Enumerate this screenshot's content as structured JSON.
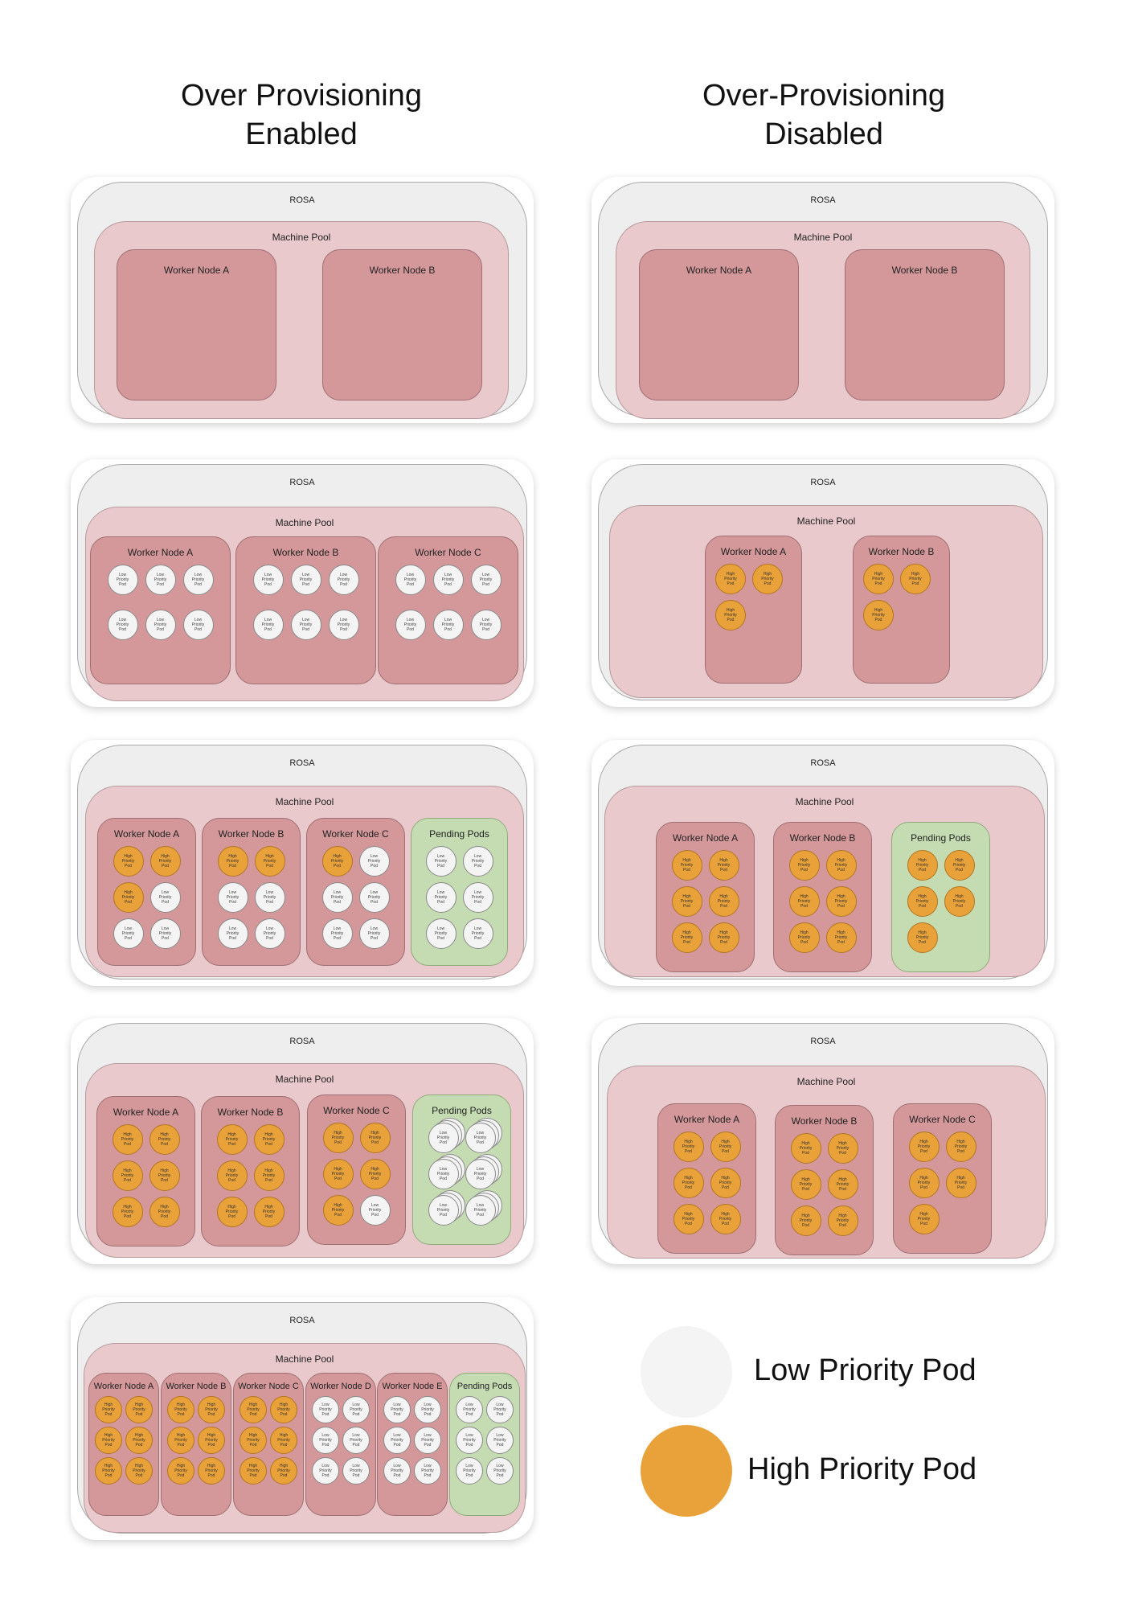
{
  "titles": {
    "left": "Over Provisioning\nEnabled",
    "right": "Over-Provisioning\nDisabled"
  },
  "labels": {
    "rosa": "ROSA",
    "machine_pool": "Machine Pool",
    "low_pod": "Low\nPriority\nPod",
    "high_pod": "High\nPriority\nPod"
  },
  "colors": {
    "low_pod": "#f4f4f4",
    "high_pod": "#e9a13a",
    "worker_node": "#d4989b",
    "pending_node": "#c5dcb3",
    "machine_pool": "#e9c9cb",
    "rosa": "#eeeeee"
  },
  "legend": {
    "low": "Low Priority Pod",
    "high": "High Priority Pod"
  },
  "diagrams": [
    {
      "id": "left-1",
      "nodes": [
        {
          "label": "Worker Node A",
          "pending": false,
          "pods": []
        },
        {
          "label": "Worker Node B",
          "pending": false,
          "pods": []
        }
      ]
    },
    {
      "id": "left-2",
      "nodes": [
        {
          "label": "Worker Node A",
          "pending": false,
          "pods": [
            "low",
            "low",
            "low",
            "low",
            "low",
            "low"
          ]
        },
        {
          "label": "Worker Node B",
          "pending": false,
          "pods": [
            "low",
            "low",
            "low",
            "low",
            "low",
            "low"
          ]
        },
        {
          "label": "Worker Node C",
          "pending": false,
          "pods": [
            "low",
            "low",
            "low",
            "low",
            "low",
            "low"
          ]
        }
      ]
    },
    {
      "id": "left-3",
      "nodes": [
        {
          "label": "Worker Node A",
          "pending": false,
          "pods": [
            "high",
            "high",
            "high",
            "low",
            "low",
            "low"
          ]
        },
        {
          "label": "Worker Node B",
          "pending": false,
          "pods": [
            "high",
            "high",
            "low",
            "low",
            "low",
            "low"
          ]
        },
        {
          "label": "Worker Node C",
          "pending": false,
          "pods": [
            "high",
            "low",
            "low",
            "low",
            "low",
            "low"
          ]
        },
        {
          "label": "Pending Pods",
          "pending": true,
          "pods": [
            "low",
            "low",
            "low",
            "low",
            "low",
            "low"
          ]
        }
      ]
    },
    {
      "id": "left-4",
      "nodes": [
        {
          "label": "Worker Node A",
          "pending": false,
          "pods": [
            "high",
            "high",
            "high",
            "high",
            "high",
            "high"
          ]
        },
        {
          "label": "Worker Node B",
          "pending": false,
          "pods": [
            "high",
            "high",
            "high",
            "high",
            "high",
            "high"
          ]
        },
        {
          "label": "Worker Node C",
          "pending": false,
          "pods": [
            "high",
            "high",
            "high",
            "high",
            "high",
            "low"
          ]
        },
        {
          "label": "Pending Pods",
          "pending": true,
          "pods": [
            "low-stack",
            "low-stack",
            "low-stack",
            "low-stack",
            "low-stack",
            "low-stack"
          ]
        }
      ]
    },
    {
      "id": "left-5",
      "nodes": [
        {
          "label": "Worker Node A",
          "pending": false,
          "pods": [
            "high",
            "high",
            "high",
            "high",
            "high",
            "high"
          ]
        },
        {
          "label": "Worker Node B",
          "pending": false,
          "pods": [
            "high",
            "high",
            "high",
            "high",
            "high",
            "high"
          ]
        },
        {
          "label": "Worker Node C",
          "pending": false,
          "pods": [
            "high",
            "high",
            "high",
            "high",
            "high",
            "high"
          ]
        },
        {
          "label": "Worker Node D",
          "pending": false,
          "pods": [
            "low",
            "low",
            "low",
            "low",
            "low",
            "low"
          ]
        },
        {
          "label": "Worker Node E",
          "pending": false,
          "pods": [
            "low",
            "low",
            "low",
            "low",
            "low",
            "low"
          ]
        },
        {
          "label": "Pending Pods",
          "pending": true,
          "pods": [
            "low",
            "low",
            "low",
            "low",
            "low",
            "low"
          ]
        }
      ]
    },
    {
      "id": "right-1",
      "nodes": [
        {
          "label": "Worker Node A",
          "pending": false,
          "pods": []
        },
        {
          "label": "Worker Node B",
          "pending": false,
          "pods": []
        }
      ]
    },
    {
      "id": "right-2",
      "nodes": [
        {
          "label": "Worker Node A",
          "pending": false,
          "pods": [
            "high",
            "high",
            "high"
          ]
        },
        {
          "label": "Worker Node B",
          "pending": false,
          "pods": [
            "high",
            "high",
            "high"
          ]
        }
      ]
    },
    {
      "id": "right-3",
      "nodes": [
        {
          "label": "Worker Node A",
          "pending": false,
          "pods": [
            "high",
            "high",
            "high",
            "high",
            "high",
            "high"
          ]
        },
        {
          "label": "Worker Node B",
          "pending": false,
          "pods": [
            "high",
            "high",
            "high",
            "high",
            "high",
            "high"
          ]
        },
        {
          "label": "Pending Pods",
          "pending": true,
          "pods": [
            "high",
            "high",
            "high",
            "high",
            "high"
          ]
        }
      ]
    },
    {
      "id": "right-4",
      "nodes": [
        {
          "label": "Worker Node A",
          "pending": false,
          "pods": [
            "high",
            "high",
            "high",
            "high",
            "high",
            "high"
          ]
        },
        {
          "label": "Worker Node B",
          "pending": false,
          "pods": [
            "high",
            "high",
            "high",
            "high",
            "high",
            "high"
          ]
        },
        {
          "label": "Worker Node C",
          "pending": false,
          "pods": [
            "high",
            "high",
            "high",
            "high",
            "high"
          ]
        }
      ]
    }
  ]
}
